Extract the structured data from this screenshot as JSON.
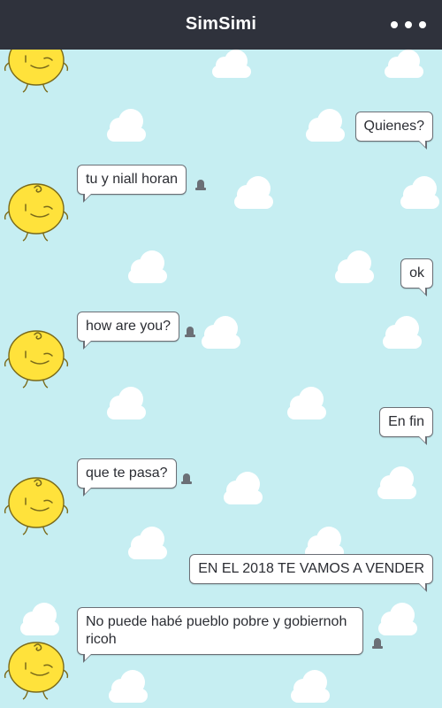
{
  "app": {
    "title": "SimSimi"
  },
  "colors": {
    "header": "#2f323c",
    "background": "#c6eef2",
    "avatar": "#ffe23b"
  },
  "icons": {
    "menu": "more-dots-icon",
    "report": "report-icon",
    "avatar": "simsimi-avatar-icon"
  },
  "messages": [
    {
      "from": "user",
      "text": "Quienes?"
    },
    {
      "from": "bot",
      "text": "tu y niall horan"
    },
    {
      "from": "user",
      "text": "ok"
    },
    {
      "from": "bot",
      "text": "how are you?"
    },
    {
      "from": "user",
      "text": "En fin"
    },
    {
      "from": "bot",
      "text": "que te pasa?"
    },
    {
      "from": "user",
      "text": "EN EL 2018 TE VAMOS A VENDER"
    },
    {
      "from": "bot",
      "text": "No puede habé pueblo pobre y gobiernoh ricoh"
    }
  ]
}
